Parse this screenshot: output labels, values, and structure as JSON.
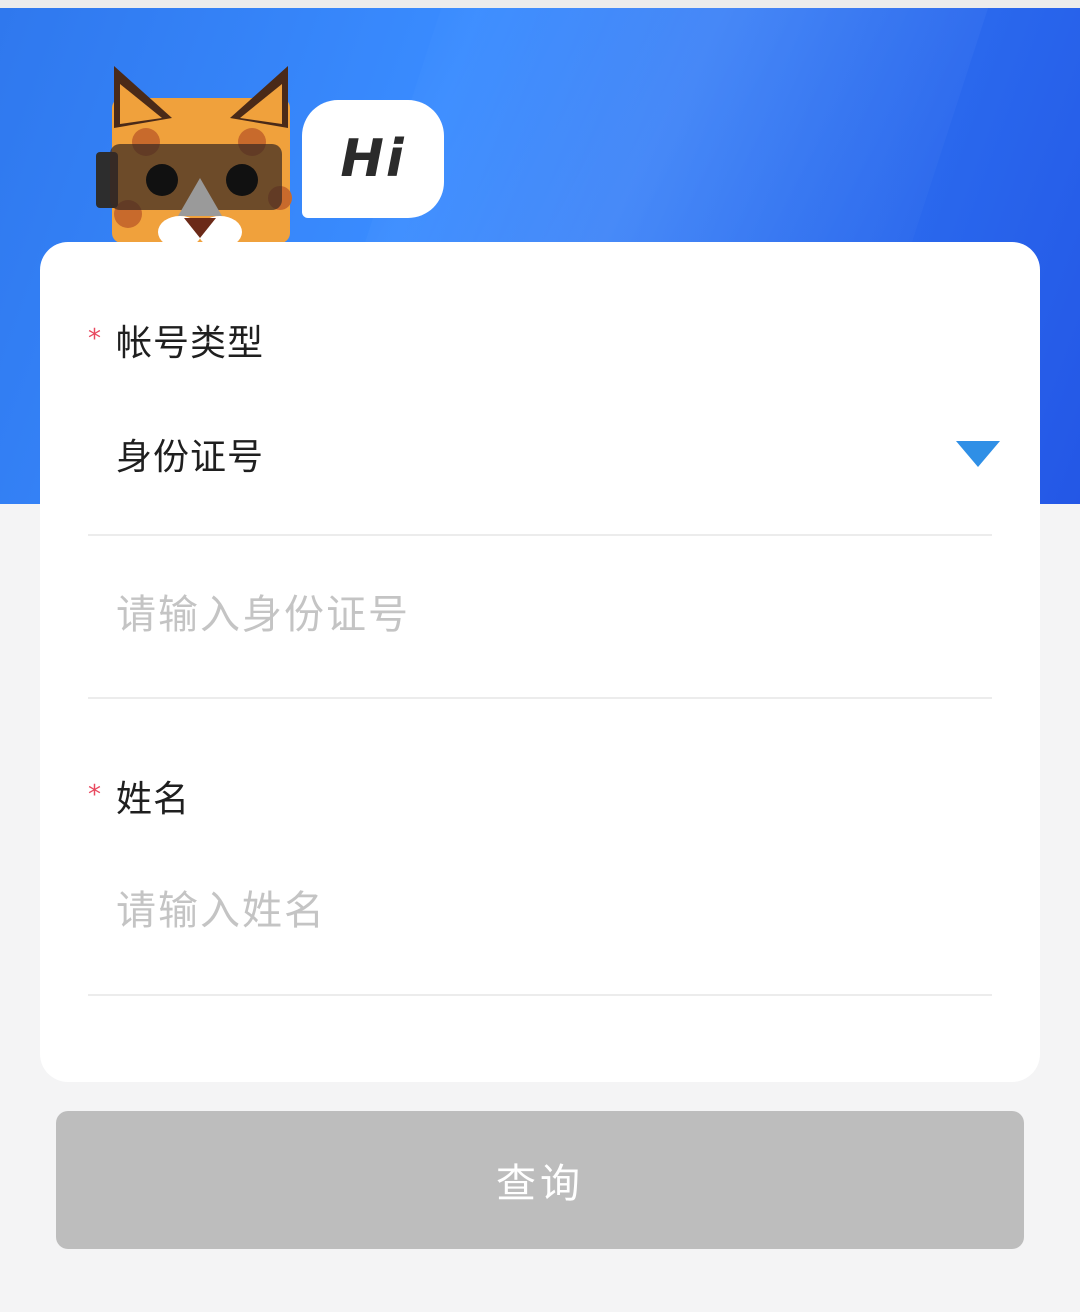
{
  "header": {
    "greeting": "Hi",
    "mascot_icon": "cat-mascot-icon",
    "background_colors": [
      "#2f78ee",
      "#3a8cff",
      "#2457e6"
    ]
  },
  "form": {
    "account_type": {
      "required_mark": "*",
      "label": "帐号类型",
      "selected_value": "身份证号",
      "dropdown_icon": "triangle-down-icon"
    },
    "id_number": {
      "value": "",
      "placeholder": "请输入身份证号"
    },
    "name": {
      "required_mark": "*",
      "label": "姓名",
      "value": "",
      "placeholder": "请输入姓名"
    }
  },
  "actions": {
    "query_label": "查询",
    "query_enabled": false
  },
  "colors": {
    "accent": "#2f8fe6",
    "required": "#e8495f",
    "button_disabled": "#bdbdbd",
    "placeholder": "#c4c4c4"
  }
}
